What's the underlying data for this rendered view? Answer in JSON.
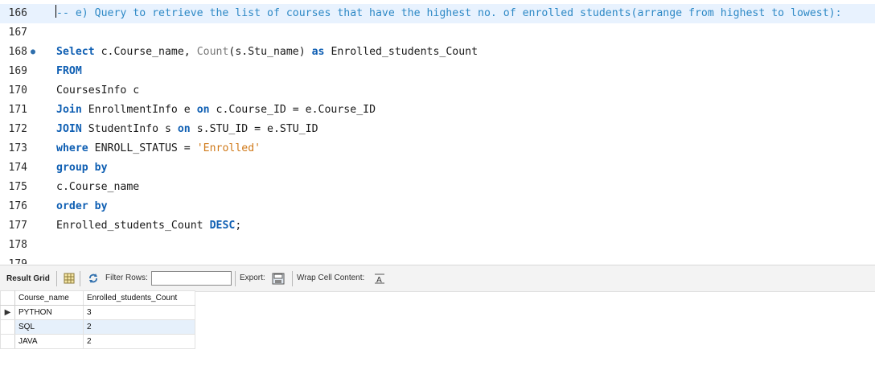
{
  "editor": {
    "lines": [
      {
        "num": "166",
        "parts": [
          {
            "t": "-- e) Query to retrieve the list of courses that have the highest no. of enrolled students(arrange from highest to lowest):",
            "c": "cm"
          }
        ]
      },
      {
        "num": "167",
        "parts": []
      },
      {
        "num": "168",
        "bp": "●",
        "parts": [
          {
            "t": "Select",
            "c": "kw"
          },
          {
            "t": " c.Course_name, "
          },
          {
            "t": "Count",
            "c": "fn"
          },
          {
            "t": "(s.Stu_name) "
          },
          {
            "t": "as",
            "c": "kw"
          },
          {
            "t": " Enrolled_students_Count"
          }
        ]
      },
      {
        "num": "169",
        "parts": [
          {
            "t": "FROM",
            "c": "kw"
          }
        ]
      },
      {
        "num": "170",
        "parts": [
          {
            "t": "CoursesInfo c"
          }
        ]
      },
      {
        "num": "171",
        "parts": [
          {
            "t": "Join",
            "c": "kw"
          },
          {
            "t": " EnrollmentInfo e "
          },
          {
            "t": "on",
            "c": "kw"
          },
          {
            "t": " c.Course_ID = e.Course_ID"
          }
        ]
      },
      {
        "num": "172",
        "parts": [
          {
            "t": "JOIN",
            "c": "kw"
          },
          {
            "t": " StudentInfo s "
          },
          {
            "t": "on",
            "c": "kw"
          },
          {
            "t": " s.STU_ID = e.STU_ID"
          }
        ]
      },
      {
        "num": "173",
        "parts": [
          {
            "t": "where",
            "c": "kw"
          },
          {
            "t": " ENROLL_STATUS = "
          },
          {
            "t": "'Enrolled'",
            "c": "str"
          }
        ]
      },
      {
        "num": "174",
        "parts": [
          {
            "t": "group by",
            "c": "kw"
          }
        ]
      },
      {
        "num": "175",
        "parts": [
          {
            "t": "c.Course_name"
          }
        ]
      },
      {
        "num": "176",
        "parts": [
          {
            "t": "order by",
            "c": "kw"
          }
        ]
      },
      {
        "num": "177",
        "parts": [
          {
            "t": "Enrolled_students_Count "
          },
          {
            "t": "DESC",
            "c": "kw"
          },
          {
            "t": ";"
          }
        ]
      },
      {
        "num": "178",
        "parts": []
      },
      {
        "num": "179",
        "parts": []
      }
    ]
  },
  "toolbar": {
    "result_grid_label": "Result Grid",
    "filter_rows_label": "Filter Rows:",
    "filter_value": "",
    "export_label": "Export:",
    "wrap_label": "Wrap Cell Content:",
    "icons": [
      "grid-view-icon",
      "refresh-icon",
      "export-file-icon",
      "wrap-text-icon"
    ]
  },
  "grid": {
    "columns": [
      "Course_name",
      "Enrolled_students_Count"
    ],
    "rows": [
      [
        "PYTHON",
        "3"
      ],
      [
        "SQL",
        "2"
      ],
      [
        "JAVA",
        "2"
      ]
    ]
  },
  "colors": {
    "keyword": "#0f5fb3",
    "comment": "#2e89c6",
    "string": "#d07a1a",
    "current_line": "#e8f2fe",
    "alt_row": "#e6f0fb"
  }
}
